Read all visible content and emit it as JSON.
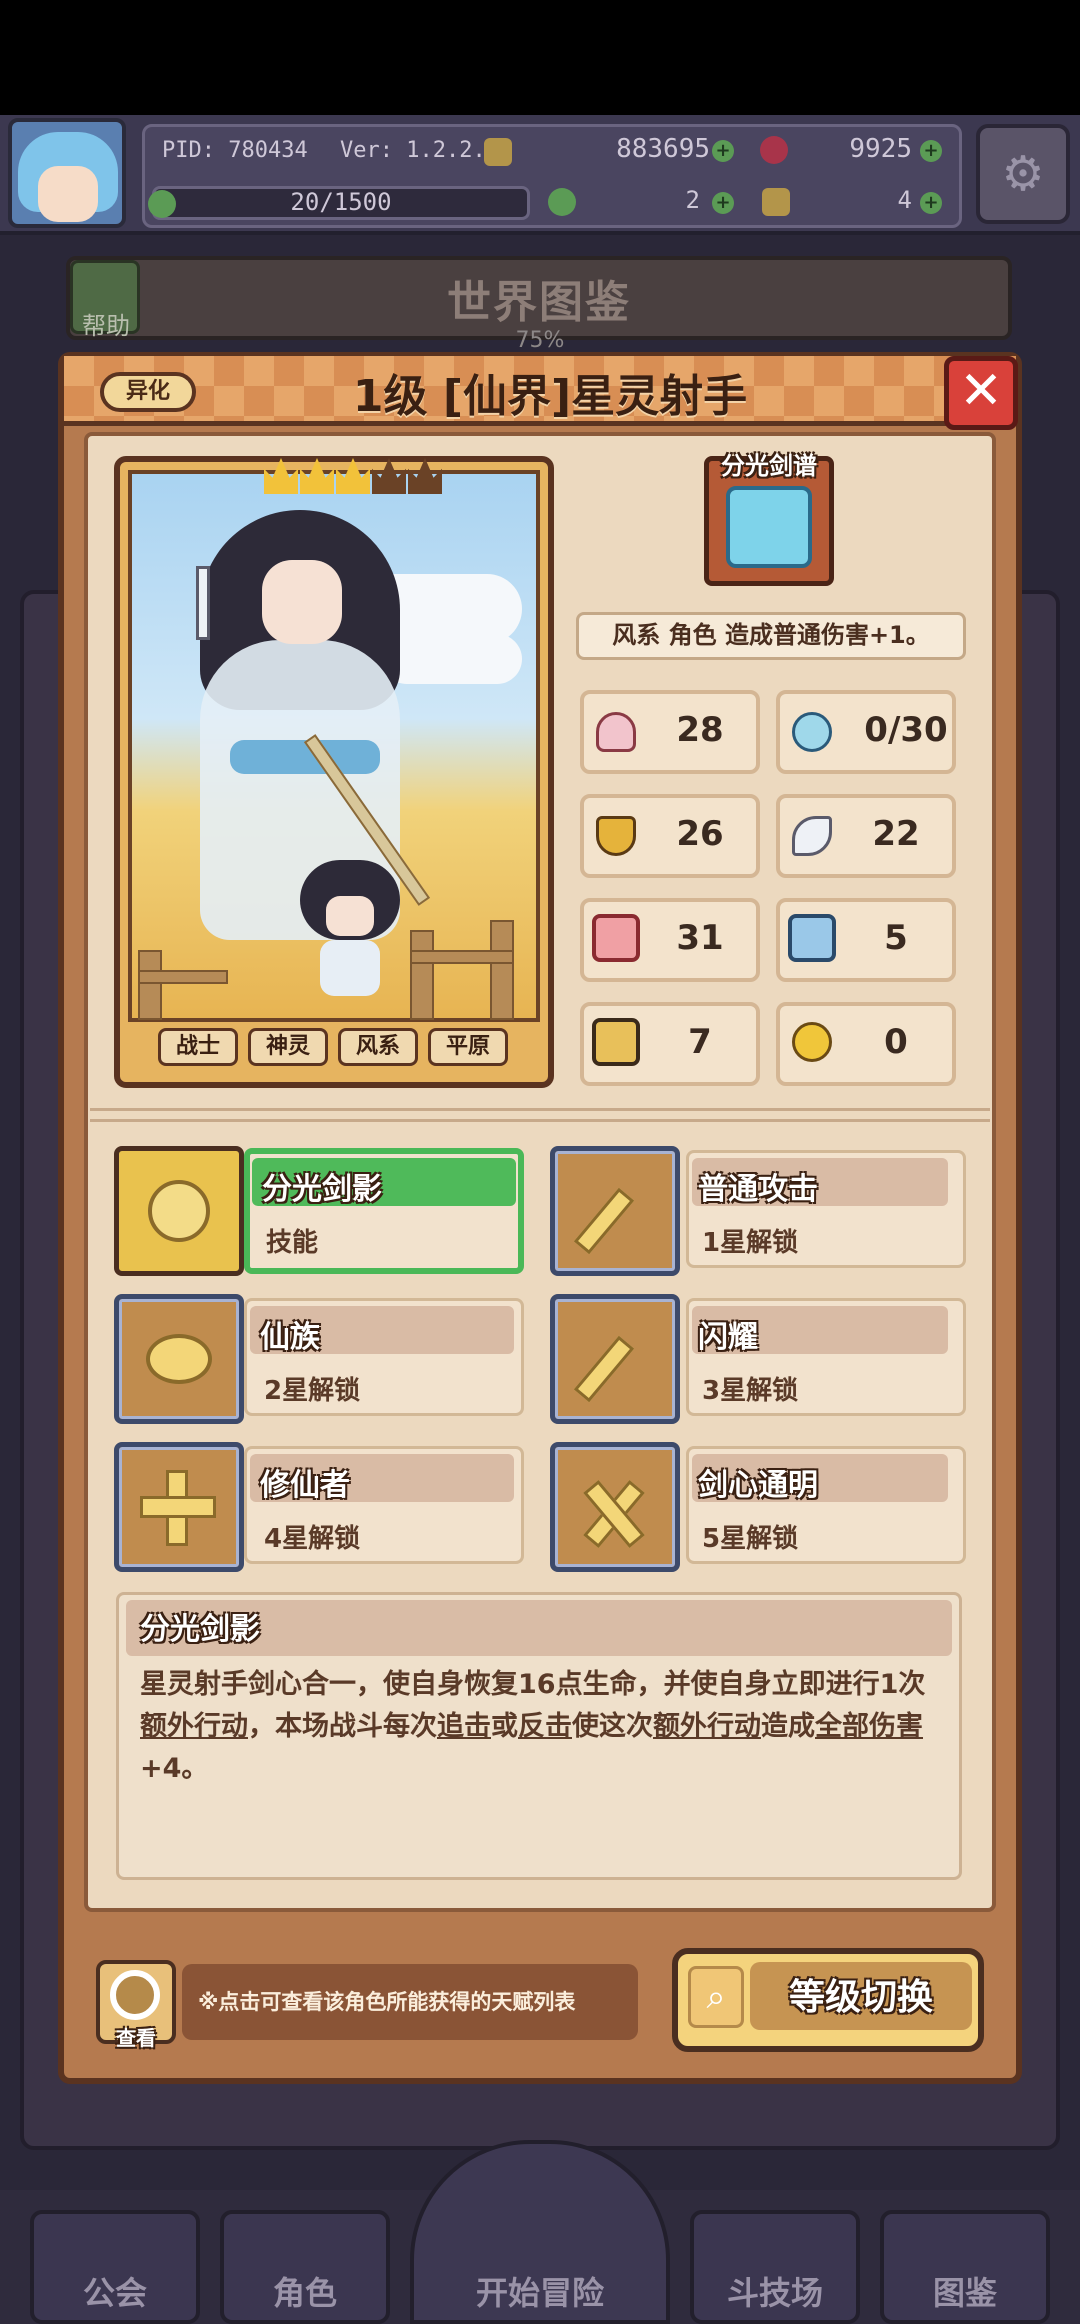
{
  "topbar": {
    "pid": "PID: 780434",
    "version": "Ver: 1.2.2.5",
    "gold": "883695",
    "gems": "9925",
    "energy": "20/1500",
    "clovers": "2",
    "keys": "4"
  },
  "background": {
    "world_title": "世界图鉴",
    "help_label": "帮助",
    "progress": "75%",
    "nav": [
      "公会",
      "角色",
      "开始冒险",
      "斗技场",
      "图鉴"
    ]
  },
  "modal": {
    "badge": "异化",
    "title": "1级 [仙界]星灵射手",
    "close_icon": "close-icon"
  },
  "card": {
    "stars_filled": 3,
    "stars_total": 5,
    "tags": [
      "战士",
      "神灵",
      "风系",
      "平原"
    ]
  },
  "equipment": {
    "name": "分光剑谱",
    "effect": "风系 角色 造成普通伤害+1。"
  },
  "stats": [
    {
      "icon": "heart-icon",
      "value": "28"
    },
    {
      "icon": "water-drop-icon",
      "value": "0/30"
    },
    {
      "icon": "shield-icon",
      "value": "26"
    },
    {
      "icon": "wing-icon",
      "value": "22"
    },
    {
      "icon": "fist-icon",
      "value": "31"
    },
    {
      "icon": "book-icon",
      "value": "5"
    },
    {
      "icon": "boot-icon",
      "value": "7"
    },
    {
      "icon": "alarm-icon",
      "value": "0"
    }
  ],
  "skills": [
    {
      "name": "分光剑影",
      "sub": "技能",
      "icon": "heart-shield-icon",
      "selected": true
    },
    {
      "name": "普通攻击",
      "sub": "1星解锁",
      "icon": "sword-icon"
    },
    {
      "name": "仙族",
      "sub": "2星解锁",
      "icon": "ring-icon"
    },
    {
      "name": "闪耀",
      "sub": "3星解锁",
      "icon": "sword-icon"
    },
    {
      "name": "修仙者",
      "sub": "4星解锁",
      "icon": "cross-icon"
    },
    {
      "name": "剑心通明",
      "sub": "5星解锁",
      "icon": "crossed-swords-icon"
    }
  ],
  "description": {
    "title": "分光剑影",
    "p1": "星灵射手剑心合一，使自身恢复16点生命，并使自身立即进行1次",
    "p2a": "额外行动",
    "p2b": "，本场战斗每次",
    "p2c": "追击",
    "p2d": "或",
    "p2e": "反击",
    "p2f": "使这次",
    "p2g": "额外行动",
    "p2h": "造成",
    "p2i": "全部伤害",
    "p3": "+4。"
  },
  "footer": {
    "view_label": "查看",
    "tip": "※点击可查看该角色所能获得的天赋列表",
    "switch_label": "等级切换"
  }
}
